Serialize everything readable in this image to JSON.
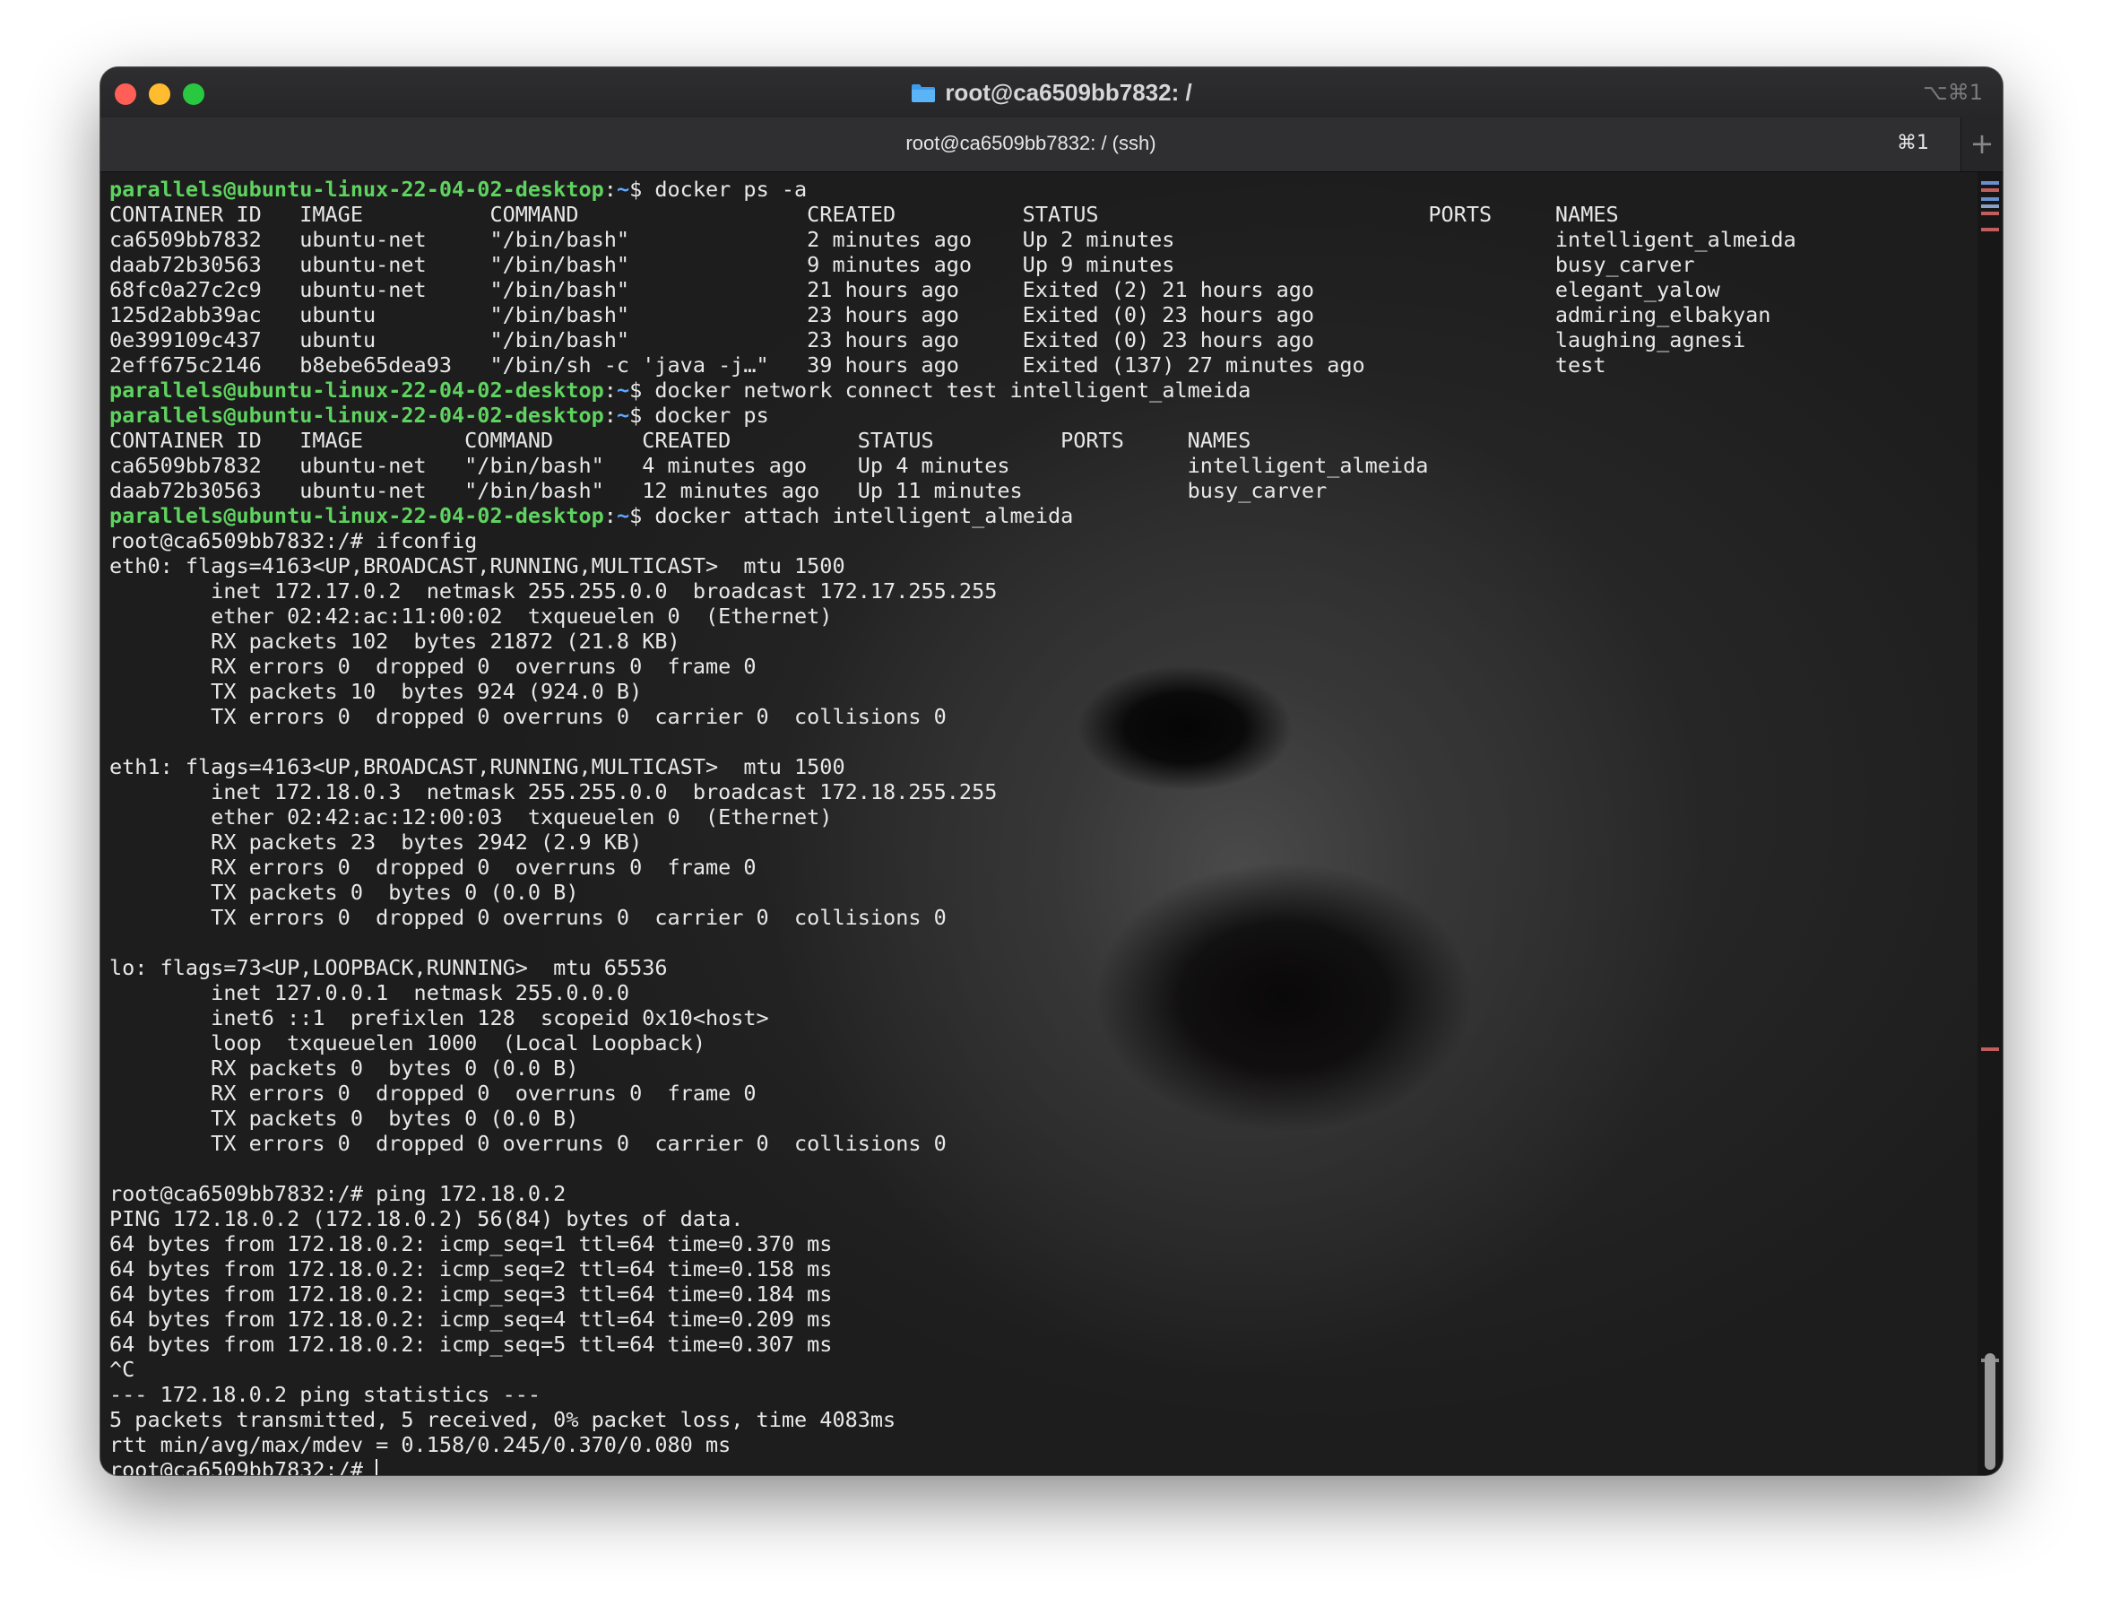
{
  "window": {
    "title": "root@ca6509bb7832: /",
    "shortcut": "⌥⌘1"
  },
  "tab": {
    "title": "root@ca6509bb7832: / (ssh)",
    "shortcut": "⌘1",
    "new_tab_label": "+"
  },
  "icons": {
    "folder": "folder-icon",
    "new_tab": "plus-icon"
  },
  "colors": {
    "prompt_user": "#5fd35f",
    "prompt_path": "#5fa8ff",
    "text": "#e8e8e8"
  },
  "terminal": {
    "prompt_user": "parallels@ubuntu-linux-22-04-02-desktop",
    "prompt_path": "~",
    "lines": [
      {
        "type": "prompt",
        "cmd": "docker ps -a"
      },
      {
        "type": "out",
        "text": "CONTAINER ID   IMAGE          COMMAND                  CREATED          STATUS                          PORTS     NAMES"
      },
      {
        "type": "out",
        "text": "ca6509bb7832   ubuntu-net     \"/bin/bash\"              2 minutes ago    Up 2 minutes                              intelligent_almeida"
      },
      {
        "type": "out",
        "text": "daab72b30563   ubuntu-net     \"/bin/bash\"              9 minutes ago    Up 9 minutes                              busy_carver"
      },
      {
        "type": "out",
        "text": "68fc0a27c2c9   ubuntu-net     \"/bin/bash\"              21 hours ago     Exited (2) 21 hours ago                   elegant_yalow"
      },
      {
        "type": "out",
        "text": "125d2abb39ac   ubuntu         \"/bin/bash\"              23 hours ago     Exited (0) 23 hours ago                   admiring_elbakyan"
      },
      {
        "type": "out",
        "text": "0e399109c437   ubuntu         \"/bin/bash\"              23 hours ago     Exited (0) 23 hours ago                   laughing_agnesi"
      },
      {
        "type": "out",
        "text": "2eff675c2146   b8ebe65dea93   \"/bin/sh -c 'java -j…\"   39 hours ago     Exited (137) 27 minutes ago               test"
      },
      {
        "type": "prompt",
        "cmd": "docker network connect test intelligent_almeida"
      },
      {
        "type": "prompt",
        "cmd": "docker ps"
      },
      {
        "type": "out",
        "text": "CONTAINER ID   IMAGE        COMMAND       CREATED          STATUS          PORTS     NAMES"
      },
      {
        "type": "out",
        "text": "ca6509bb7832   ubuntu-net   \"/bin/bash\"   4 minutes ago    Up 4 minutes              intelligent_almeida"
      },
      {
        "type": "out",
        "text": "daab72b30563   ubuntu-net   \"/bin/bash\"   12 minutes ago   Up 11 minutes             busy_carver"
      },
      {
        "type": "prompt",
        "cmd": "docker attach intelligent_almeida"
      },
      {
        "type": "out",
        "text": "root@ca6509bb7832:/# ifconfig"
      },
      {
        "type": "out",
        "text": "eth0: flags=4163<UP,BROADCAST,RUNNING,MULTICAST>  mtu 1500"
      },
      {
        "type": "out",
        "text": "        inet 172.17.0.2  netmask 255.255.0.0  broadcast 172.17.255.255"
      },
      {
        "type": "out",
        "text": "        ether 02:42:ac:11:00:02  txqueuelen 0  (Ethernet)"
      },
      {
        "type": "out",
        "text": "        RX packets 102  bytes 21872 (21.8 KB)"
      },
      {
        "type": "out",
        "text": "        RX errors 0  dropped 0  overruns 0  frame 0"
      },
      {
        "type": "out",
        "text": "        TX packets 10  bytes 924 (924.0 B)"
      },
      {
        "type": "out",
        "text": "        TX errors 0  dropped 0 overruns 0  carrier 0  collisions 0"
      },
      {
        "type": "out",
        "text": ""
      },
      {
        "type": "out",
        "text": "eth1: flags=4163<UP,BROADCAST,RUNNING,MULTICAST>  mtu 1500"
      },
      {
        "type": "out",
        "text": "        inet 172.18.0.3  netmask 255.255.0.0  broadcast 172.18.255.255"
      },
      {
        "type": "out",
        "text": "        ether 02:42:ac:12:00:03  txqueuelen 0  (Ethernet)"
      },
      {
        "type": "out",
        "text": "        RX packets 23  bytes 2942 (2.9 KB)"
      },
      {
        "type": "out",
        "text": "        RX errors 0  dropped 0  overruns 0  frame 0"
      },
      {
        "type": "out",
        "text": "        TX packets 0  bytes 0 (0.0 B)"
      },
      {
        "type": "out",
        "text": "        TX errors 0  dropped 0 overruns 0  carrier 0  collisions 0"
      },
      {
        "type": "out",
        "text": ""
      },
      {
        "type": "out",
        "text": "lo: flags=73<UP,LOOPBACK,RUNNING>  mtu 65536"
      },
      {
        "type": "out",
        "text": "        inet 127.0.0.1  netmask 255.0.0.0"
      },
      {
        "type": "out",
        "text": "        inet6 ::1  prefixlen 128  scopeid 0x10<host>"
      },
      {
        "type": "out",
        "text": "        loop  txqueuelen 1000  (Local Loopback)"
      },
      {
        "type": "out",
        "text": "        RX packets 0  bytes 0 (0.0 B)"
      },
      {
        "type": "out",
        "text": "        RX errors 0  dropped 0  overruns 0  frame 0"
      },
      {
        "type": "out",
        "text": "        TX packets 0  bytes 0 (0.0 B)"
      },
      {
        "type": "out",
        "text": "        TX errors 0  dropped 0 overruns 0  carrier 0  collisions 0"
      },
      {
        "type": "out",
        "text": ""
      },
      {
        "type": "out",
        "text": "root@ca6509bb7832:/# ping 172.18.0.2"
      },
      {
        "type": "out",
        "text": "PING 172.18.0.2 (172.18.0.2) 56(84) bytes of data."
      },
      {
        "type": "out",
        "text": "64 bytes from 172.18.0.2: icmp_seq=1 ttl=64 time=0.370 ms"
      },
      {
        "type": "out",
        "text": "64 bytes from 172.18.0.2: icmp_seq=2 ttl=64 time=0.158 ms"
      },
      {
        "type": "out",
        "text": "64 bytes from 172.18.0.2: icmp_seq=3 ttl=64 time=0.184 ms"
      },
      {
        "type": "out",
        "text": "64 bytes from 172.18.0.2: icmp_seq=4 ttl=64 time=0.209 ms"
      },
      {
        "type": "out",
        "text": "64 bytes from 172.18.0.2: icmp_seq=5 ttl=64 time=0.307 ms"
      },
      {
        "type": "out",
        "text": "^C"
      },
      {
        "type": "out",
        "text": "--- 172.18.0.2 ping statistics ---"
      },
      {
        "type": "out",
        "text": "5 packets transmitted, 5 received, 0% packet loss, time 4083ms"
      },
      {
        "type": "out",
        "text": "rtt min/avg/max/mdev = 0.158/0.245/0.370/0.080 ms"
      },
      {
        "type": "cursor",
        "text": "root@ca6509bb7832:/# "
      }
    ]
  }
}
